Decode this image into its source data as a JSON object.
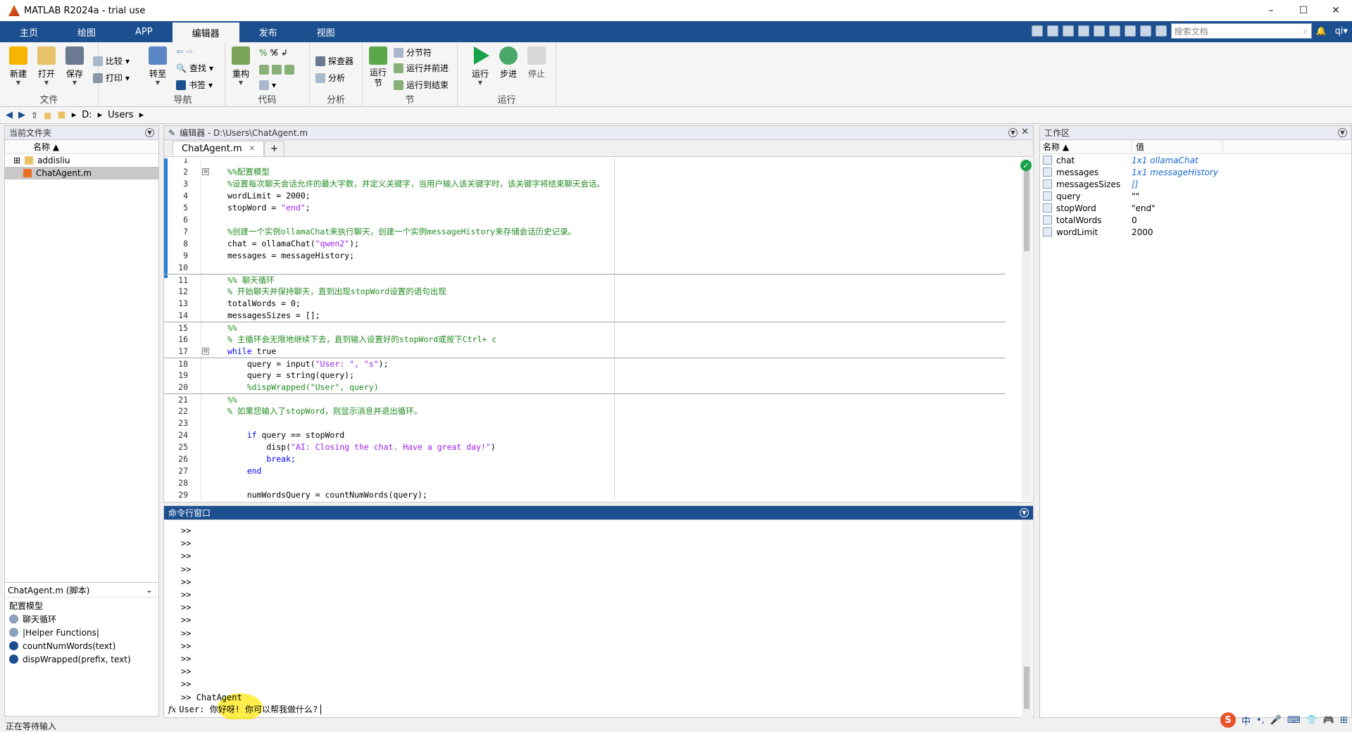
{
  "window": {
    "title": "MATLAB R2024a - trial use",
    "min": "–",
    "max": "☐",
    "close": "✕"
  },
  "tabs": [
    "主页",
    "绘图",
    "APP",
    "编辑器",
    "发布",
    "视图"
  ],
  "active_tab": "编辑器",
  "quick": {
    "search_placeholder": "搜索文档",
    "user": "qi▾"
  },
  "ribbon": {
    "file": {
      "label": "文件",
      "new": "新建",
      "open": "打开",
      "save": "保存",
      "compare": "比较",
      "print": "打印"
    },
    "nav": {
      "label": "导航",
      "goto": "转至",
      "find": "查找",
      "bookmark": "书签"
    },
    "code": {
      "label": "代码",
      "refactor": "重构"
    },
    "analyze": {
      "label": "分析",
      "profiler": "探查器",
      "analyze": "分析"
    },
    "section": {
      "label": "节",
      "run_section": "运行\n节",
      "section_break": "分节符",
      "run_advance": "运行并前进",
      "run_to_end": "运行到结束"
    },
    "run": {
      "label": "运行",
      "run": "运行",
      "step": "步进",
      "stop": "停止"
    }
  },
  "address": {
    "drive": "D:",
    "folder": "Users"
  },
  "current_folder": {
    "title": "当前文件夹",
    "col_name": "名称 ▲",
    "items": [
      {
        "name": "addisliu",
        "expand": "⊞"
      },
      {
        "name": "ChatAgent.m"
      }
    ]
  },
  "details": {
    "title": "ChatAgent.m (脚本)",
    "chevron": "⌄",
    "heading": "配置模型",
    "items": [
      "聊天循环",
      "|Helper Functions|",
      "countNumWords(text)",
      "dispWrapped(prefix, text)"
    ]
  },
  "editor": {
    "title": "编辑器 - D:\\Users\\ChatAgent.m",
    "tab": "ChatAgent.m",
    "plus": "+",
    "ok": "✓",
    "lines": [
      {
        "n": "1",
        "t": "",
        "cls": ""
      },
      {
        "n": "2",
        "t": "%%配置模型",
        "cls": "c"
      },
      {
        "n": "3",
        "t": "%设置每次聊天会话允许的最大字数，并定义关键字，当用户输入该关键字时，该关键字将结束聊天会话。",
        "cls": "c"
      },
      {
        "n": "4",
        "t": "wordLimit = 2000;",
        "cls": ""
      },
      {
        "n": "5",
        "t": "stopWord = ",
        "s": "\"end\"",
        "t2": ";",
        "cls": ""
      },
      {
        "n": "6",
        "t": "",
        "cls": ""
      },
      {
        "n": "7",
        "t": "%创建一个实例ollamaChat来执行聊天，创建一个实例messageHistory来存储会话历史记录。",
        "cls": "c"
      },
      {
        "n": "8",
        "t": "chat = ollamaChat(",
        "s": "\"qwen2\"",
        "t2": ");",
        "cls": ""
      },
      {
        "n": "9",
        "t": "messages = messageHistory;",
        "cls": ""
      },
      {
        "n": "10",
        "t": "",
        "cls": ""
      },
      {
        "n": "11",
        "t": "%% 聊天循环",
        "cls": "c"
      },
      {
        "n": "12",
        "t": "% 开始聊天并保持聊天，直到出现stopWord设置的语句出现",
        "cls": "c"
      },
      {
        "n": "13",
        "t": "totalWords = 0;",
        "cls": ""
      },
      {
        "n": "14",
        "t": "messagesSizes = [];",
        "cls": ""
      },
      {
        "n": "15",
        "t": "%%",
        "cls": "c"
      },
      {
        "n": "16",
        "t": "% 主循环会无限地继续下去，直到输入设置好的stopWord或按下Ctrl+ c",
        "cls": "c"
      },
      {
        "n": "17",
        "t": "while",
        "t2": " true",
        "cls": "kw"
      },
      {
        "n": "18",
        "t": "    query = input(",
        "s": "\"User: \", \"s\"",
        "t2": ");",
        "cls": ""
      },
      {
        "n": "19",
        "t": "    query = string(query);",
        "cls": ""
      },
      {
        "n": "20",
        "t": "    %dispWrapped(\"User\", query)",
        "cls": "c"
      },
      {
        "n": "21",
        "t": "%%",
        "cls": "c"
      },
      {
        "n": "22",
        "t": "% 如果您输入了stopWord，则显示消息并退出循环。",
        "cls": "c"
      },
      {
        "n": "23",
        "t": "",
        "cls": ""
      },
      {
        "n": "24",
        "t": "    ",
        "k": "if",
        "t2": " query == stopWord",
        "cls": ""
      },
      {
        "n": "25",
        "t": "        disp(",
        "s": "\"AI: Closing the chat. Have a great day!\"",
        "t2": ")",
        "cls": ""
      },
      {
        "n": "26",
        "t": "        break;",
        "cls": "k"
      },
      {
        "n": "27",
        "t": "    ",
        "k": "end",
        "t2": "",
        "cls": ""
      },
      {
        "n": "28",
        "t": "",
        "cls": ""
      },
      {
        "n": "29",
        "t": "    numWordsQuery = countNumWords(query);",
        "cls": ""
      }
    ]
  },
  "command": {
    "title": "命令行窗口",
    "prompt": ">>",
    "history_count": 13,
    "last_cmd": "ChatAgent",
    "fx": "fx",
    "current": "User: 你好呀! 你可以帮我做什么?"
  },
  "workspace": {
    "title": "工作区",
    "col_name": "名称 ▲",
    "col_value": "值",
    "vars": [
      {
        "name": "chat",
        "value": "1x1 ollamaChat",
        "obj": true
      },
      {
        "name": "messages",
        "value": "1x1 messageHistory",
        "obj": true
      },
      {
        "name": "messagesSizes",
        "value": "[]",
        "obj": true
      },
      {
        "name": "query",
        "value": "\"\"",
        "obj": false
      },
      {
        "name": "stopWord",
        "value": "\"end\"",
        "obj": false
      },
      {
        "name": "totalWords",
        "value": "0",
        "obj": false
      },
      {
        "name": "wordLimit",
        "value": "2000",
        "obj": false
      }
    ]
  },
  "status": {
    "text": "正在等待输入"
  },
  "tray": {
    "ime": "S",
    "items": [
      "中",
      "•,",
      "🎤",
      "⌨",
      "👕",
      "🎮",
      "⊞"
    ]
  }
}
